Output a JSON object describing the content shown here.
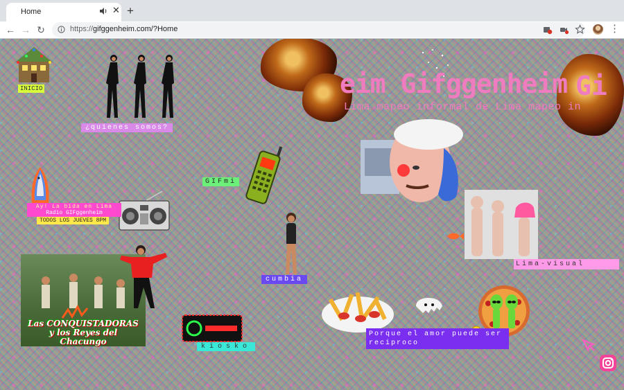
{
  "browser": {
    "tab": {
      "title": "Home"
    },
    "new_tab_symbol": "+",
    "close_symbol": "✕",
    "back_symbol": "←",
    "forward_symbol": "→",
    "reload_symbol": "↻",
    "url_scheme": "https://",
    "url_rest": "gifggenheim.com/?Home",
    "menu_symbol": "⋮"
  },
  "site": {
    "title": "eim Gifggenheim",
    "title_tail": "Gi",
    "subtitle": "Lima mapeo informal de Lima mapeo in",
    "nav": {
      "inicio": "INICIO",
      "quienes": "¿quienes somos?",
      "gifmi": "GIFmi",
      "radio_line1": "Ay! La bida en Lima",
      "radio_line2": "Radio GIFggenheim",
      "radio_line3": "TODOS LOS JUEVES 8PM",
      "cumbia": "cumbia",
      "lima_visual": "Lima-visual",
      "kiosko": "kiosko",
      "porque": "Porque el amor puede ser reciproco"
    },
    "band_text": "Las CONQUISTADORAS y los Reyes del Chacungo"
  },
  "colors": {
    "accent_pink": "#f07cc0",
    "instagram": "#f4449a"
  },
  "icons": {
    "info": "info-circle-icon",
    "audio": "speaker-icon",
    "instagram": "instagram-icon",
    "arrow": "cursor-arrow-icon"
  }
}
